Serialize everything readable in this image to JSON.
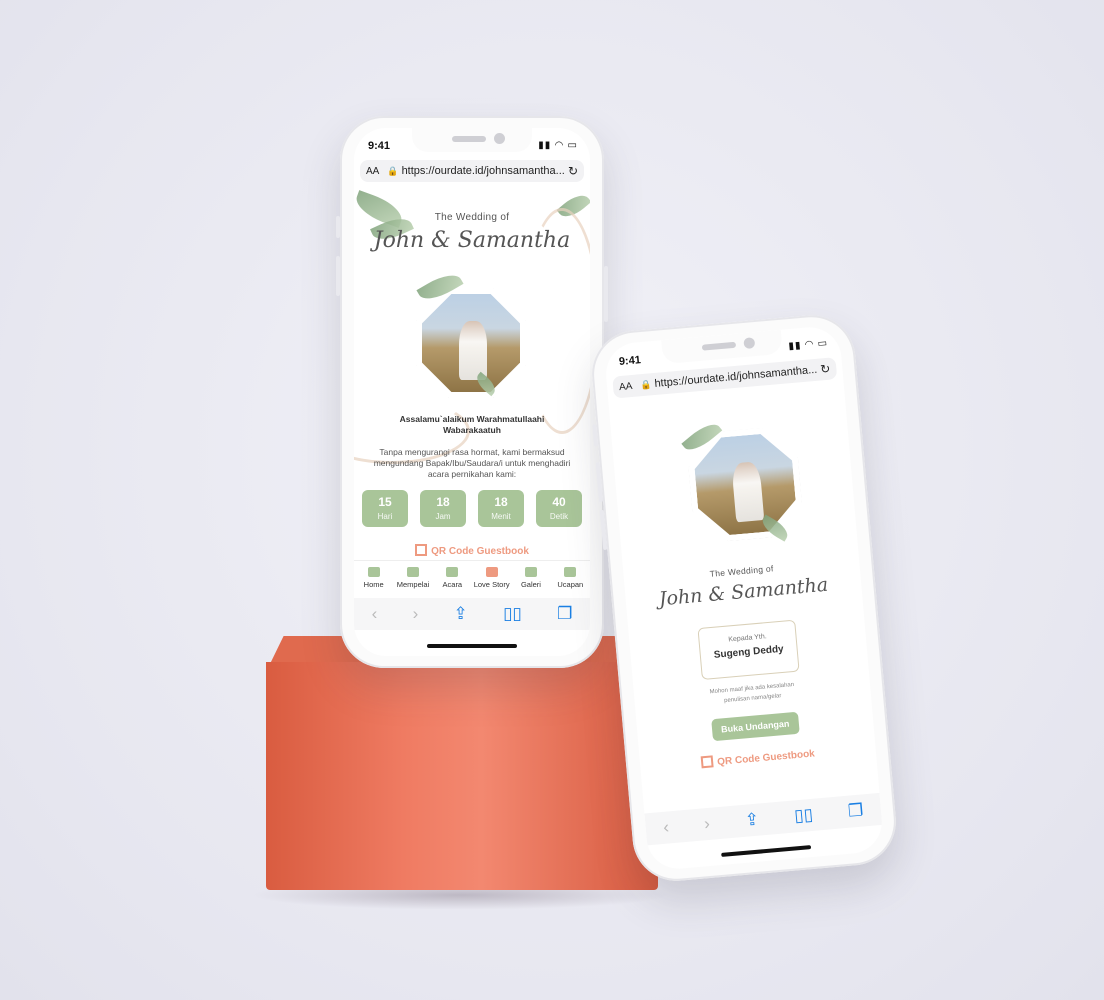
{
  "back_phone": {
    "status_time": "9:41",
    "url_aa": "AA",
    "url": "https://ourdate.id/johnsamantha...",
    "wedding_of": "The Wedding of",
    "couple": "John & Samantha",
    "greeting": "Assalamu`alaikum Warahmatullaahi Wabarakaatuh",
    "intro": "Tanpa mengurangi rasa hormat, kami bermaksud mengundang Bapak/Ibu/Saudara/i untuk menghadiri acara pernikahan kami:",
    "countdown": [
      {
        "value": "15",
        "label": "Hari"
      },
      {
        "value": "18",
        "label": "Jam"
      },
      {
        "value": "18",
        "label": "Menit"
      },
      {
        "value": "40",
        "label": "Detik"
      }
    ],
    "qr_label": "QR Code Guestbook",
    "nav": [
      "Home",
      "Mempelai",
      "Acara",
      "Love Story",
      "Galeri",
      "Ucapan"
    ]
  },
  "front_phone": {
    "status_time": "9:41",
    "url_aa": "AA",
    "url": "https://ourdate.id/johnsamantha...",
    "wedding_of": "The Wedding of",
    "couple": "John & Samantha",
    "to_label": "Kepada Yth.",
    "guest_name": "Sugeng Deddy",
    "note": "Mohon maaf jika ada kesalahan penulisan nama/gelar",
    "open_button": "Buka Undangan",
    "qr_label": "QR Code Guestbook"
  },
  "colors": {
    "accent_green": "#a9c599",
    "accent_peach": "#ee9a80",
    "box": "#e8735a"
  }
}
